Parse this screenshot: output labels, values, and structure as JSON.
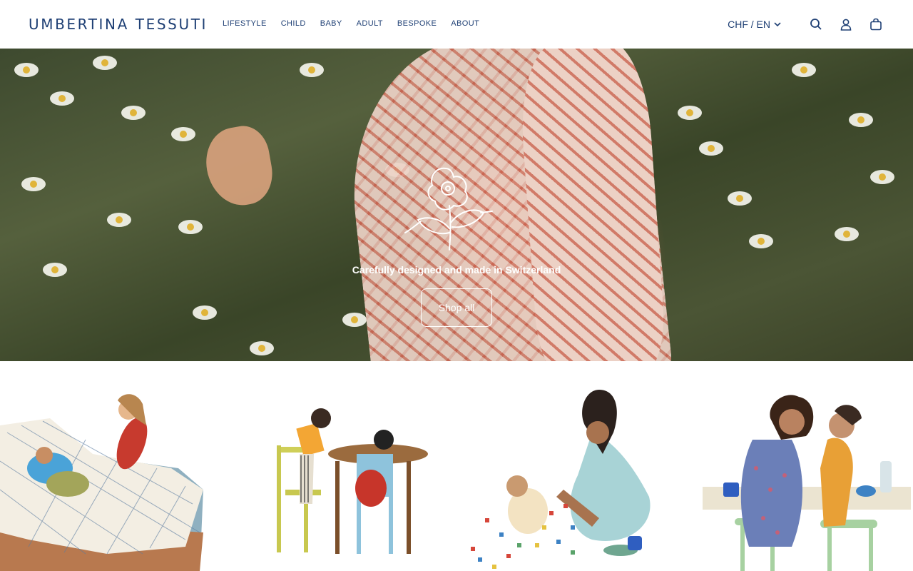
{
  "header": {
    "logo": "UMBERTINA TESSUTI",
    "nav": [
      "LIFESTYLE",
      "CHILD",
      "BABY",
      "ADULT",
      "BESPOKE",
      "ABOUT"
    ],
    "locale": "CHF / EN",
    "icons": [
      "search-icon",
      "account-icon",
      "cart-icon"
    ]
  },
  "hero": {
    "tagline": "Carefully designed and made in Switzerland",
    "cta": "Shop all"
  },
  "categories": [
    {
      "name": "illustration-children-on-bed"
    },
    {
      "name": "illustration-children-drawing-at-table"
    },
    {
      "name": "illustration-mother-and-baby-playing"
    },
    {
      "name": "illustration-mother-and-child-at-table"
    }
  ],
  "colors": {
    "brand": "#1e3f74",
    "white": "#ffffff"
  }
}
